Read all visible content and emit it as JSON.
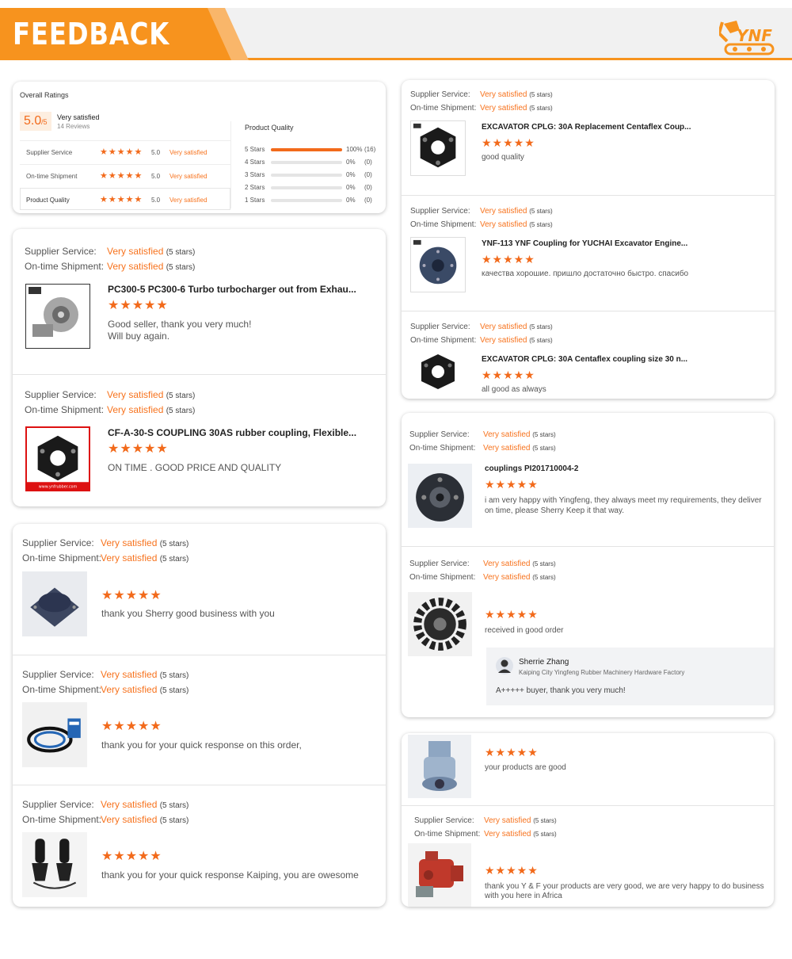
{
  "banner": {
    "title": "FEEDBACK",
    "logo_text": "YNF"
  },
  "ratings": {
    "heading": "Overall Ratings",
    "score": "5.0",
    "out_of": "/5",
    "level": "Very satisfied",
    "reviews": "14 Reviews",
    "rows": [
      {
        "label": "Supplier Service",
        "stars": "★★★★★",
        "score": "5.0",
        "level": "Very satisfied"
      },
      {
        "label": "On-time Shipment",
        "stars": "★★★★★",
        "score": "5.0",
        "level": "Very satisfied"
      },
      {
        "label": "Product Quality",
        "stars": "★★★★★",
        "score": "5.0",
        "level": "Very satisfied"
      }
    ],
    "pq_heading": "Product Quality",
    "dist": [
      {
        "label": "5 Stars",
        "pct": "100%",
        "count": "(16)",
        "fill": 1.0
      },
      {
        "label": "4 Stars",
        "pct": "0%",
        "count": "(0)",
        "fill": 0
      },
      {
        "label": "3 Stars",
        "pct": "0%",
        "count": "(0)",
        "fill": 0
      },
      {
        "label": "2 Stars",
        "pct": "0%",
        "count": "(0)",
        "fill": 0
      },
      {
        "label": "1 Stars",
        "pct": "0%",
        "count": "(0)",
        "fill": 0
      }
    ]
  },
  "common": {
    "supplier": "Supplier Service:",
    "shipment": "On-time Shipment:",
    "very": "Very satisfied",
    "five": "(5 stars)",
    "stars": "★★★★★"
  },
  "reviews": [
    {
      "title": "PC300-5 PC300-6 Turbo turbocharger out from Exhau...",
      "comment": "Good seller, thank you very much!",
      "comment2": "Will buy again."
    },
    {
      "title": "CF-A-30-S COUPLING 30AS rubber coupling, Flexible...",
      "comment": "ON TIME . GOOD PRICE AND QUALITY"
    },
    {
      "comment": "thank you Sherry good business with you"
    },
    {
      "comment": "thank you for your quick response on this order,"
    },
    {
      "comment": "thank you for your quick response Kaiping, you are owesome"
    },
    {
      "title": "EXCAVATOR CPLG: 30A Replacement Centaflex Coup...",
      "comment": "good quality"
    },
    {
      "title": "YNF-113 YNF Coupling for YUCHAI Excavator Engine...",
      "comment": "качества хорошие. пришло достаточно быстро. спасибо"
    },
    {
      "title": "EXCAVATOR CPLG: 30A Centaflex coupling size 30 n...",
      "comment": "all good as always"
    },
    {
      "title": "couplings PI201710004-2",
      "comment": "i am very happy with Yingfeng, they always meet my requirements, they deliver on time, please Sherry Keep it that way."
    },
    {
      "comment": "received in good order"
    },
    {
      "comment": "your products are good"
    },
    {
      "comment": "thank you Y & F your products are very good, we are very happy to do business with you here in Africa"
    }
  ],
  "reply": {
    "name": "Sherrie Zhang",
    "company": "Kaiping City Yingfeng Rubber Machinery Hardware Factory",
    "text": "A+++++ buyer, thank you very much!"
  },
  "watermark": "www.ynfrubber.com"
}
